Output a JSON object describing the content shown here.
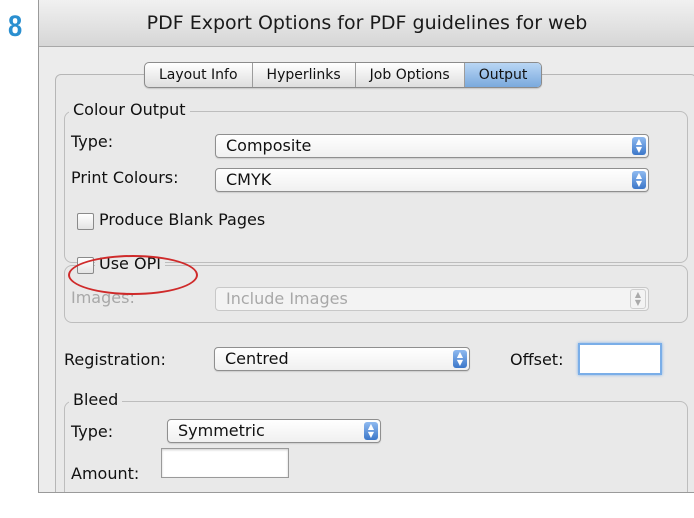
{
  "step_number": "8",
  "window": {
    "title": "PDF Export Options for PDF guidelines for web"
  },
  "tabs": [
    {
      "label": "Layout Info",
      "active": false
    },
    {
      "label": "Hyperlinks",
      "active": false
    },
    {
      "label": "Job Options",
      "active": false
    },
    {
      "label": "Output",
      "active": true
    }
  ],
  "colour_output": {
    "title": "Colour Output",
    "type_label": "Type:",
    "type_value": "Composite",
    "print_colours_label": "Print Colours:",
    "print_colours_value": "CMYK",
    "produce_blank_pages_label": "Produce Blank Pages",
    "produce_blank_pages_checked": false
  },
  "opi": {
    "use_opi_label": "Use OPI",
    "use_opi_checked": false,
    "images_label": "Images:",
    "images_value": "Include Images"
  },
  "registration": {
    "label": "Registration:",
    "value": "Centred",
    "offset_label": "Offset:",
    "offset_value": ""
  },
  "bleed": {
    "title": "Bleed",
    "type_label": "Type:",
    "type_value": "Symmetric",
    "amount_label": "Amount:",
    "amount_value": ""
  },
  "colors": {
    "step_number": "#2a8fd0",
    "annotation_circle": "#cf2a2a",
    "active_tab": "#7aa9dd"
  },
  "icons": {
    "popup_arrows": "up-down-arrows-icon"
  }
}
